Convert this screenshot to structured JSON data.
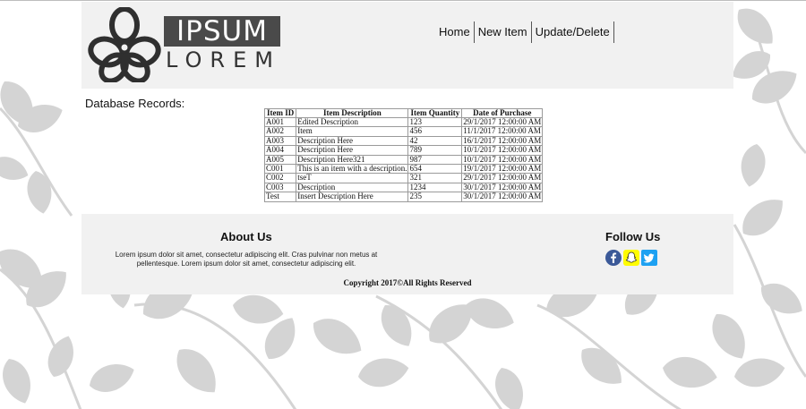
{
  "logo": {
    "top": "IPSUM",
    "bottom": "LOREM"
  },
  "nav": {
    "items": [
      "Home",
      "New Item",
      "Update/Delete"
    ]
  },
  "main": {
    "heading": "Database Records:"
  },
  "table": {
    "headers": [
      "Item ID",
      "Item Description",
      "Item Quantity",
      "Date of Purchase"
    ],
    "rows": [
      [
        "A001",
        "Edited Description",
        "123",
        "29/1/2017 12:00:00 AM"
      ],
      [
        "A002",
        "Item",
        "456",
        "11/1/2017 12:00:00 AM"
      ],
      [
        "A003",
        "Description Here",
        "42",
        "16/1/2017 12:00:00 AM"
      ],
      [
        "A004",
        "Description Here",
        "789",
        "10/1/2017 12:00:00 AM"
      ],
      [
        "A005",
        "Description Here321",
        "987",
        "10/1/2017 12:00:00 AM"
      ],
      [
        "C001",
        "This is an item with a description.",
        "654",
        "19/1/2017 12:00:00 AM"
      ],
      [
        "C002",
        "tseT",
        "321",
        "29/1/2017 12:00:00 AM"
      ],
      [
        "C003",
        "Description",
        "1234",
        "30/1/2017 12:00:00 AM"
      ],
      [
        "Test",
        "Insert Description Here",
        "235",
        "30/1/2017 12:00:00 AM"
      ]
    ]
  },
  "footer": {
    "about_title": "About Us",
    "about_text": "Lorem ipsum dolor sit amet, consectetur adipiscing elit. Cras pulvinar non metus at pellentesque. Lorem ipsum dolor sit amet, consectetur adipiscing elit.",
    "follow_title": "Follow Us",
    "social": [
      "facebook-icon",
      "snapchat-icon",
      "twitter-icon"
    ],
    "copyright": "Copyright 2017©All Rights Reserved"
  },
  "colors": {
    "panel": "#f1f1f1",
    "logo_block": "#4a4a4a",
    "leaf": "#d4d4d4",
    "facebook": "#3b5998",
    "snapchat": "#fffc00",
    "twitter": "#1da1f2"
  }
}
